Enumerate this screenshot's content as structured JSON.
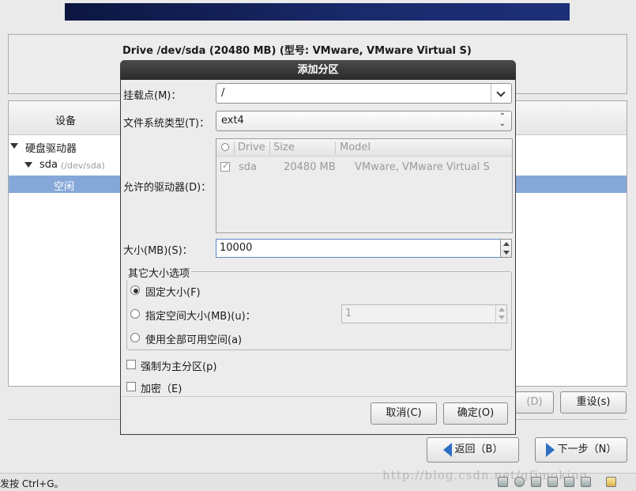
{
  "background": {
    "drive_label": "Drive /dev/sda (20480 MB) (型号: VMware, VMware Virtual S)",
    "tree": {
      "col_device": "设备",
      "hdd_label": "硬盘驱动器",
      "sda_label": "sda",
      "sda_path": "(/dev/sda)",
      "free_label": "空闲"
    },
    "buttons": {
      "delete_partial": "(D)",
      "reset": "重设(s)",
      "reset_mn": "s",
      "back": "返回（B）",
      "next": "下一步（N）"
    }
  },
  "status_text": "发按 Ctrl+G。",
  "watermark": "http://blog.csdn.net/gfjmoking",
  "dialog": {
    "title": "添加分区",
    "mount_label": "挂载点(M)：",
    "mount_value": "/",
    "fstype_label": "文件系统类型(T)：",
    "fstype_value": "ext4",
    "drives_label": "允许的驱动器(D)：",
    "drives_table": {
      "headers": [
        "Drive",
        "Size",
        "Model"
      ],
      "rows": [
        {
          "drive": "sda",
          "size": "20480 MB",
          "model": "VMware, VMware Virtual S",
          "checked": true
        }
      ]
    },
    "size_label": "大小(MB)(S)：",
    "size_value": "10000",
    "other_options_legend": "其它大小选项",
    "opt_fixed": "固定大小(F)",
    "opt_upto": "指定空间大小(MB)(u)：",
    "opt_upto_value": "1",
    "opt_fill": "使用全部可用空间(a)",
    "selected_option": "fixed",
    "force_primary": "强制为主分区(p)",
    "encrypt": "加密（E)",
    "cancel": "取消(C)",
    "ok": "确定(O)"
  },
  "colors": {
    "selection": "#86a8d8",
    "title_bar": "#2a2a2a",
    "arrow_blue": "#2f6fc4"
  }
}
